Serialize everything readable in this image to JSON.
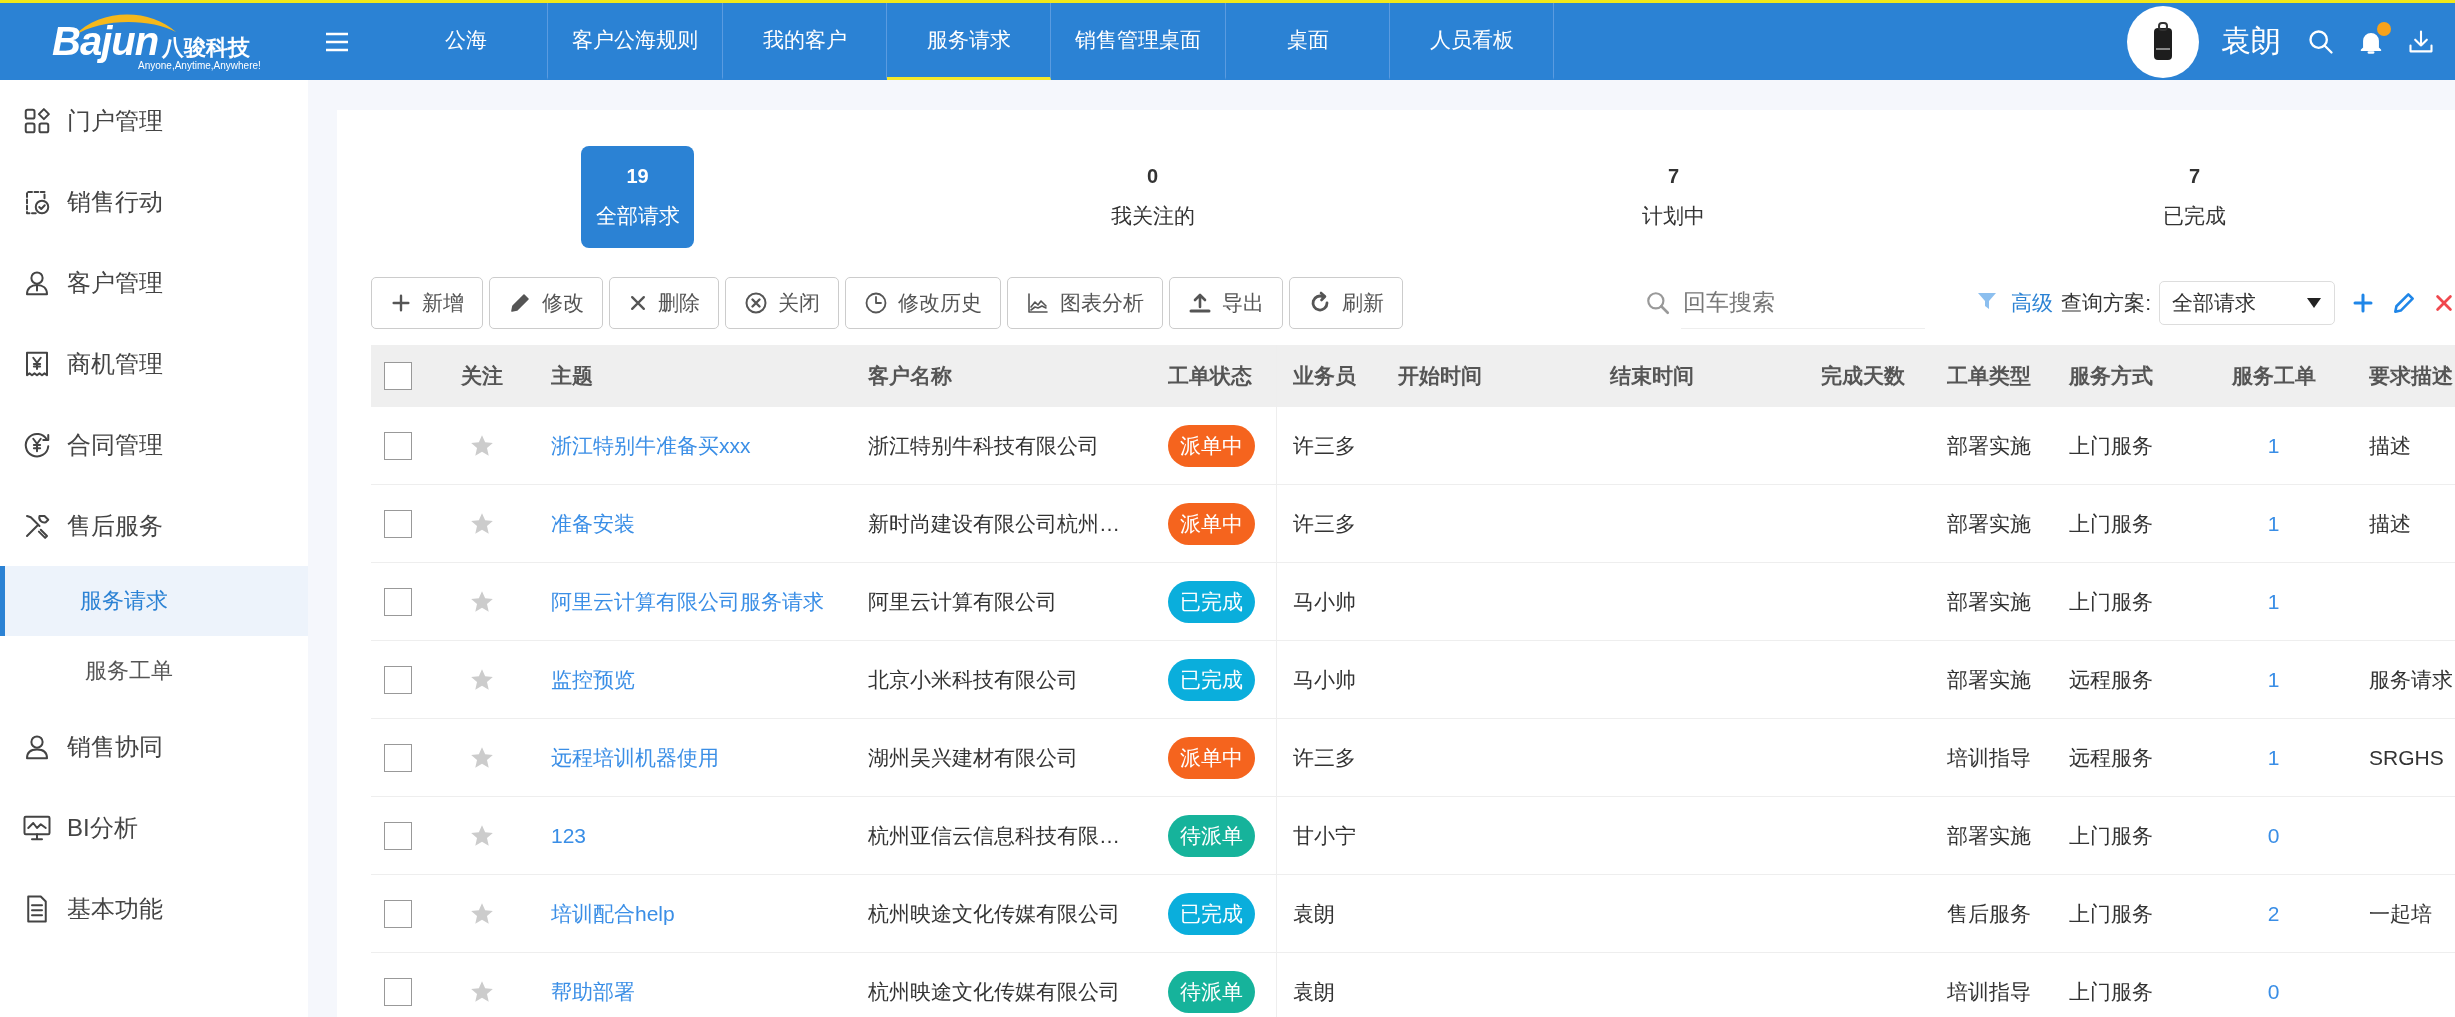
{
  "logo": {
    "brand": "Bajun",
    "name": "八骏科技",
    "tagline": "Anyone,Anytime,Anywhere!"
  },
  "nav_tabs": [
    {
      "label": "公海",
      "selected": false
    },
    {
      "label": "客户公海规则",
      "selected": false
    },
    {
      "label": "我的客户",
      "selected": false
    },
    {
      "label": "服务请求",
      "selected": true
    },
    {
      "label": "销售管理桌面",
      "selected": false
    },
    {
      "label": "桌面",
      "selected": false
    },
    {
      "label": "人员看板",
      "selected": false
    }
  ],
  "user": {
    "name": "袁朗",
    "has_notification": true
  },
  "sidebar": {
    "items": [
      {
        "label": "门户管理",
        "selected": false
      },
      {
        "label": "销售行动",
        "selected": false
      },
      {
        "label": "客户管理",
        "selected": false
      },
      {
        "label": "商机管理",
        "selected": false
      },
      {
        "label": "合同管理",
        "selected": false
      },
      {
        "label": "售后服务",
        "selected": false,
        "children": [
          {
            "label": "服务请求",
            "selected": true
          },
          {
            "label": "服务工单",
            "selected": false
          }
        ]
      },
      {
        "label": "销售协同",
        "selected": false
      },
      {
        "label": "BI分析",
        "selected": false
      },
      {
        "label": "基本功能",
        "selected": false
      }
    ]
  },
  "summary": [
    {
      "count": "19",
      "label": "全部请求",
      "selected": true
    },
    {
      "count": "0",
      "label": "我关注的",
      "selected": false
    },
    {
      "count": "7",
      "label": "计划中",
      "selected": false
    },
    {
      "count": "7",
      "label": "已完成",
      "selected": false
    }
  ],
  "toolbar": {
    "buttons": [
      "新增",
      "修改",
      "删除",
      "关闭",
      "修改历史",
      "图表分析",
      "导出",
      "刷新"
    ],
    "search": {
      "placeholder": "回车搜索"
    },
    "advanced": "高级",
    "scheme_label": "查询方案:",
    "scheme_value": "全部请求"
  },
  "table": {
    "select_all": false,
    "columns": [
      "关注",
      "主题",
      "客户名称",
      "工单状态",
      "业务员",
      "开始时间",
      "结束时间",
      "完成天数",
      "工单类型",
      "服务方式",
      "服务工单",
      "要求描述"
    ],
    "rows": [
      {
        "checked": false,
        "starred": false,
        "subject": "浙江特别牛准备买xxx",
        "customer": "浙江特别牛科技有限公司",
        "status": {
          "label": "派单中",
          "color": "#f5641e"
        },
        "salesperson": "许三多",
        "type": "部署实施",
        "method": "上门服务",
        "tickets": "1",
        "description": "描述"
      },
      {
        "checked": false,
        "starred": false,
        "subject": "准备安装",
        "customer": "新时尚建设有限公司杭州…",
        "status": {
          "label": "派单中",
          "color": "#f5641e"
        },
        "salesperson": "许三多",
        "type": "部署实施",
        "method": "上门服务",
        "tickets": "1",
        "description": "描述"
      },
      {
        "checked": false,
        "starred": false,
        "subject": "阿里云计算有限公司服务请求",
        "customer": "阿里云计算有限公司",
        "status": {
          "label": "已完成",
          "color": "#0aaedc"
        },
        "salesperson": "马小帅",
        "type": "部署实施",
        "method": "上门服务",
        "tickets": "1"
      },
      {
        "checked": false,
        "starred": false,
        "subject": "监控预览",
        "customer": "北京小米科技有限公司",
        "status": {
          "label": "已完成",
          "color": "#0aaedc"
        },
        "salesperson": "马小帅",
        "type": "部署实施",
        "method": "远程服务",
        "tickets": "1",
        "description": "服务请求"
      },
      {
        "checked": false,
        "starred": false,
        "subject": "远程培训机器使用",
        "customer": "湖州吴兴建材有限公司",
        "status": {
          "label": "派单中",
          "color": "#f5641e"
        },
        "salesperson": "许三多",
        "type": "培训指导",
        "method": "远程服务",
        "tickets": "1",
        "description": "SRGHS"
      },
      {
        "checked": false,
        "starred": false,
        "subject": "123",
        "customer": "杭州亚信云信息科技有限…",
        "status": {
          "label": "待派单",
          "color": "#16b39b"
        },
        "salesperson": "甘小宁",
        "type": "部署实施",
        "method": "上门服务",
        "tickets": "0"
      },
      {
        "checked": false,
        "starred": false,
        "subject": "培训配合help",
        "customer": "杭州映途文化传媒有限公司",
        "status": {
          "label": "已完成",
          "color": "#0aaedc"
        },
        "salesperson": "袁朗",
        "type": "售后服务",
        "method": "上门服务",
        "tickets": "2",
        "description": "一起培"
      },
      {
        "checked": false,
        "starred": false,
        "subject": "帮助部署",
        "customer": "杭州映途文化传媒有限公司",
        "status": {
          "label": "待派单",
          "color": "#16b39b"
        },
        "salesperson": "袁朗",
        "type": "培训指导",
        "method": "上门服务",
        "tickets": "0"
      }
    ]
  }
}
